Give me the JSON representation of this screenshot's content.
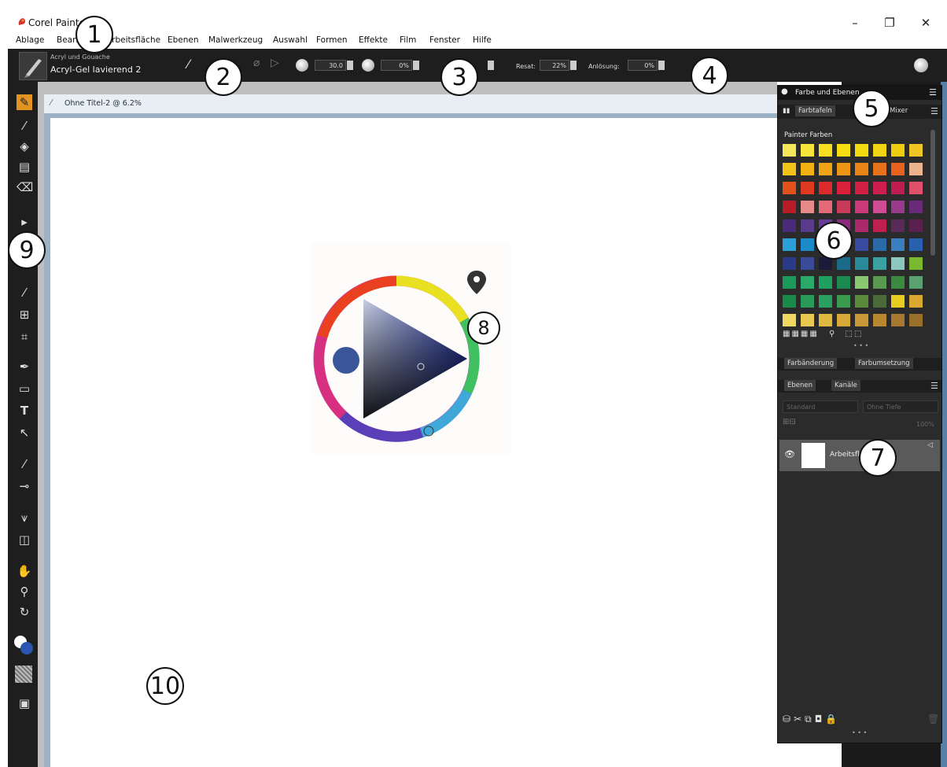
{
  "window": {
    "title": "Corel Painter",
    "minimize": "–",
    "restore": "❐",
    "close": "✕"
  },
  "menu": [
    "Ablage",
    "Bearbeiten",
    "Arbeitsfläche",
    "Ebenen",
    "Malwerkzeug",
    "Auswahl",
    "Formen",
    "Effekte",
    "Film",
    "Fenster",
    "Hilfe"
  ],
  "property_bar": {
    "brush_category": "Acryl und Gouache",
    "brush_variant": "Acryl-Gel lavierend 2",
    "size_value": "30.0",
    "opacity_value": "0%",
    "resat_label": "Resat:",
    "resat_value": "22%",
    "bleed_label": "Anlösung:",
    "bleed_value": "0%"
  },
  "document": {
    "tab_title": "Ohne Titel-2 @ 6.2%"
  },
  "color_panel": {
    "header": "Farbe und Ebenen",
    "tab_swatches": "Farbtafeln",
    "tab_other": "Mixer",
    "library_title": "Painter Farben",
    "swatch_colors": [
      [
        "#f6e65a",
        "#f7e43a",
        "#f5df20",
        "#f6de10",
        "#f2da10",
        "#f1d512",
        "#f0cc10",
        "#efc624"
      ],
      [
        "#f1c318",
        "#f0b212",
        "#efa316",
        "#ec9514",
        "#e98518",
        "#e7721c",
        "#e6621e",
        "#ecb48c"
      ],
      [
        "#e2501c",
        "#de3a20",
        "#dc2a2a",
        "#d8203a",
        "#d22044",
        "#ce1e50",
        "#c01c52",
        "#e0506a"
      ],
      [
        "#b81c28",
        "#e78a8a",
        "#e46a7a",
        "#c83a5a",
        "#cc3a7a",
        "#d04c92",
        "#9a3a8c",
        "#6a2a7a"
      ],
      [
        "#4a2a7a",
        "#5a3a8a",
        "#6a3a9a",
        "#8a2a7a",
        "#aa2a6a",
        "#c02050",
        "#5a2a5a",
        "#5a2050"
      ],
      [
        "#2aa0d8",
        "#1a8ac8",
        "#2a70b8",
        "#2a5aa8",
        "#3a4aa0",
        "#2a6aa8",
        "#3a80c0",
        "#2a60b0"
      ],
      [
        "#2a3a8a",
        "#3a4a9a",
        "#1a1a3a",
        "#1a6a8a",
        "#2a8a9a",
        "#3aa0a0",
        "#8ac8c0",
        "#7ab830"
      ],
      [
        "#1a9a5a",
        "#2aaa6a",
        "#20a060",
        "#1a8a50",
        "#8ac870",
        "#5a9a50",
        "#3a8a40",
        "#5aa070"
      ],
      [
        "#1a8a4a",
        "#2a9a5a",
        "#2aa060",
        "#3a9a50",
        "#5a8a3a",
        "#4a6a3a",
        "#e8cc20",
        "#d8a830"
      ],
      [
        "#f0d860",
        "#e8c850",
        "#e0b840",
        "#d8a838",
        "#c89838",
        "#b88830",
        "#a87830",
        "#987028"
      ]
    ],
    "tab_color_change": "Farbänderung",
    "tab_color_set": "Farbumsetzung"
  },
  "layers_panel": {
    "tab_layers": "Ebenen",
    "tab_channels": "Kanäle",
    "composite_method": "Standard",
    "depth": "Ohne Tiefe",
    "opacity": "100%",
    "layer_name": "Arbeitsfläche"
  },
  "color_wheel": {
    "current_color": "#3a559a"
  },
  "callouts": [
    "1",
    "2",
    "3",
    "4",
    "5",
    "6",
    "7",
    "8",
    "9",
    "10"
  ]
}
